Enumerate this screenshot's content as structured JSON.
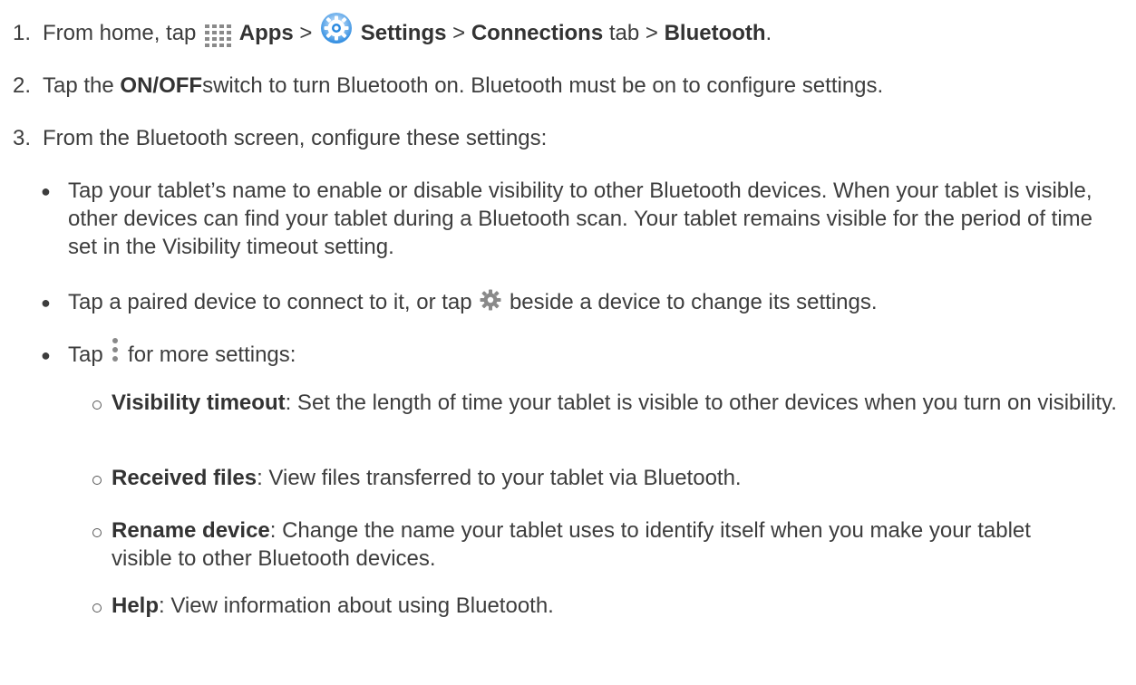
{
  "steps": [
    {
      "number": "1.",
      "t1": "From home, tap",
      "apps": "Apps",
      "sep1": ">",
      "settings": "Settings",
      "sep2": ">",
      "connections": "Connections",
      "t2": "tab >",
      "bluetooth": "Bluetooth",
      "t3": "."
    },
    {
      "number": "2.",
      "t1": "Tap the",
      "onoff": "ON/OFF",
      "t2": "switch to turn Bluetooth on. Bluetooth must be on to configure settings."
    },
    {
      "number": "3.",
      "text": "From the Bluetooth screen, configure these settings:"
    }
  ],
  "bullets": {
    "visibility": "Tap your tablet’s name to enable or disable visibility to other Bluetooth devices. When your tablet is visible, other devices can find your tablet during a Bluetooth scan. Your tablet remains visible for the period of time set in the Visibility timeout setting.",
    "paired_t1": "Tap a paired device to connect to it, or tap",
    "paired_t2": "beside a device to change its settings.",
    "more_t1": "Tap",
    "more_t2": "for more settings:"
  },
  "sub_items": [
    {
      "term": "Visibility timeout",
      "desc": ": Set the length of time your tablet is visible to other devices when you turn on visibility."
    },
    {
      "term": "Received files",
      "desc": ": View files transferred to your tablet via Bluetooth."
    },
    {
      "term": "Rename device",
      "desc": ": Change the name your tablet uses to identify itself when you make your tablet visible to other Bluetooth devices."
    },
    {
      "term": "Help",
      "desc": ": View information about using Bluetooth."
    }
  ],
  "icons": {
    "apps": "apps-grid-icon",
    "settings": "settings-gear-blue-icon",
    "device_settings": "gear-icon",
    "more_options": "vertical-dots-menu-icon"
  },
  "colors": {
    "text": "#3d3d3d",
    "settings_icon_blue": "#2b8ae0"
  }
}
